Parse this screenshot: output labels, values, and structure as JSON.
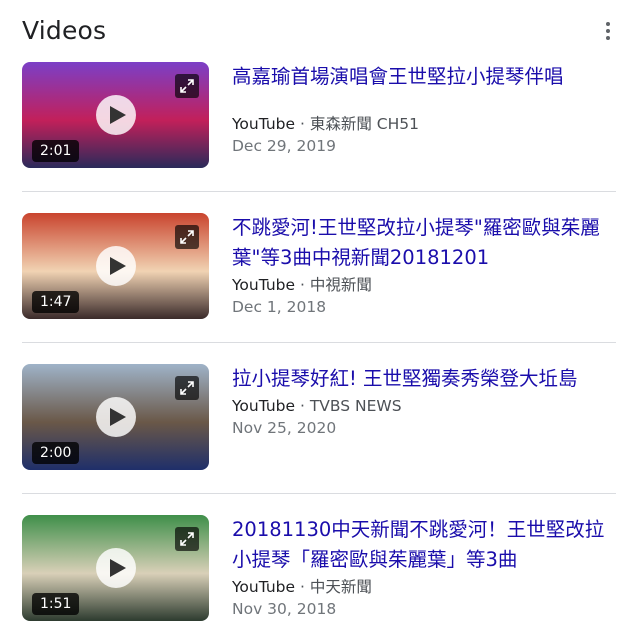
{
  "header": {
    "title": "Videos",
    "more_icon": "more-vert-icon"
  },
  "videos": [
    {
      "title": "高嘉瑜首場演唱會王世堅拉小提琴伴唱",
      "source": "YouTube",
      "channel": "東森新聞 CH51",
      "separator": " · ",
      "date": "Dec 29, 2019",
      "duration": "2:01",
      "thumb_colors": [
        "#7b3fc7",
        "#c2205a",
        "#2a2a5a"
      ]
    },
    {
      "title": "不跳愛河!王世堅改拉小提琴\"羅密歐與茱麗葉\"等3曲中視新聞20181201",
      "source": "YouTube",
      "channel": "中視新聞",
      "separator": " · ",
      "date": "Dec 1, 2018",
      "duration": "1:47",
      "thumb_colors": [
        "#c9442e",
        "#f1d3b3",
        "#3a2a2a"
      ]
    },
    {
      "title": "拉小提琴好紅! 王世堅獨奏秀榮登大坵島",
      "source": "YouTube",
      "channel": "TVBS NEWS",
      "separator": " · ",
      "date": "Nov 25, 2020",
      "duration": "2:00",
      "thumb_colors": [
        "#9fb3c8",
        "#6a5848",
        "#1f2f6a"
      ]
    },
    {
      "title": "20181130中天新聞不跳愛河！王世堅改拉小提琴「羅密歐與茱麗葉」等3曲",
      "source": "YouTube",
      "channel": "中天新聞",
      "separator": " · ",
      "date": "Nov 30, 2018",
      "duration": "1:51",
      "thumb_colors": [
        "#3f8f4a",
        "#d9d0b8",
        "#2d3b2f"
      ]
    }
  ]
}
